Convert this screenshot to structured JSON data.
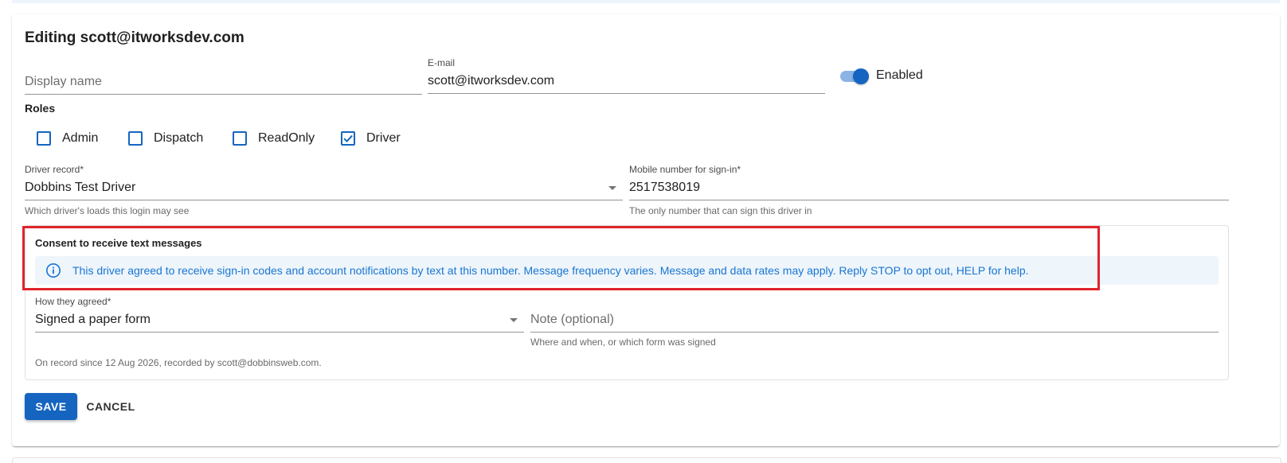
{
  "form": {
    "title": "Editing scott@itworksdev.com",
    "display_name": {
      "placeholder": "Display name",
      "value": ""
    },
    "email": {
      "label": "E-mail",
      "value": "scott@itworksdev.com"
    },
    "enabled": {
      "label": "Enabled",
      "on": true
    },
    "roles": {
      "label": "Roles",
      "items": [
        {
          "label": "Admin",
          "checked": false
        },
        {
          "label": "Dispatch",
          "checked": false
        },
        {
          "label": "ReadOnly",
          "checked": false
        },
        {
          "label": "Driver",
          "checked": true
        }
      ]
    },
    "driver_record": {
      "label": "Driver record*",
      "value": "Dobbins Test Driver",
      "hint": "Which driver's loads this login may see"
    },
    "mobile": {
      "label": "Mobile number for sign-in*",
      "value": "2517538019",
      "hint": "The only number that can sign this driver in"
    },
    "consent": {
      "title": "Consent to receive text messages",
      "info": "This driver agreed to receive sign-in codes and account notifications by text at this number. Message frequency varies. Message and data rates may apply. Reply STOP to opt out, HELP for help.",
      "how_agreed": {
        "label": "How they agreed*",
        "value": "Signed a paper form"
      },
      "note": {
        "placeholder": "Note (optional)",
        "hint": "Where and when, or which form was signed"
      },
      "record": "On record since 12 Aug 2026, recorded by scott@dobbinsweb.com."
    },
    "actions": {
      "save": "SAVE",
      "cancel": "CANCEL"
    }
  },
  "colors": {
    "primary": "#1565c0",
    "info_text": "#1976d2",
    "info_bg": "#eef5fb",
    "highlight": "#e0252b"
  }
}
